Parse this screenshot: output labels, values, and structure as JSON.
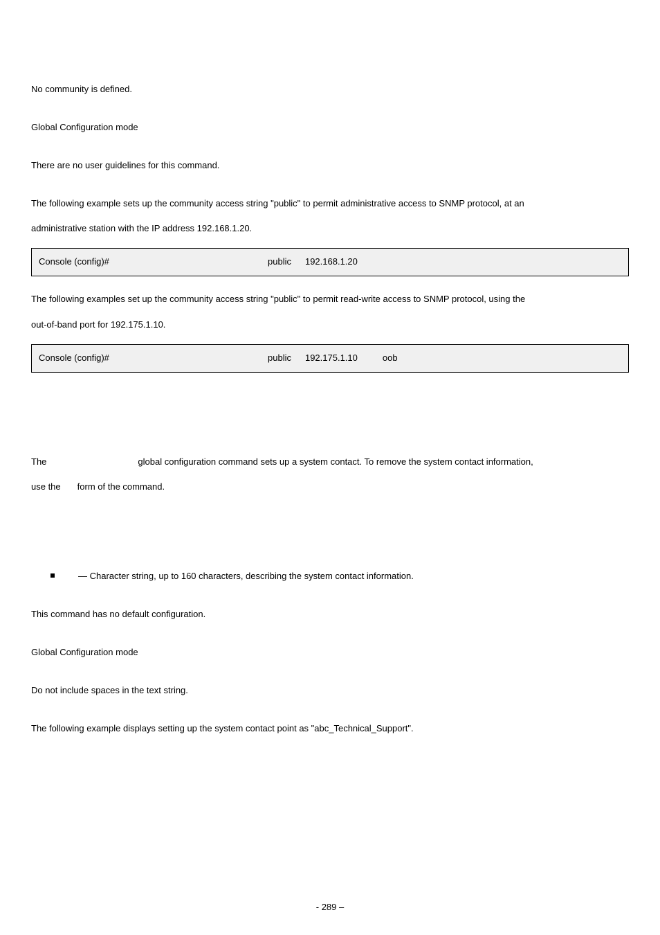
{
  "default_config": "No community is defined.",
  "command_mode": "Global Configuration mode",
  "user_guidelines_1": "There are no user guidelines for this command.",
  "example_intro_1a": "The following example sets up the community access string \"public\" to permit administrative access to SNMP protocol, at an",
  "example_intro_1b": "administrative station with the IP address 192.168.1.20.",
  "code1": {
    "prompt": "Console (config)#",
    "p1": "public",
    "p2": "192.168.1.20"
  },
  "example_intro_2a": "The following examples set up the community access string \"public\" to permit read-write access to SNMP protocol, using the",
  "example_intro_2b": "out-of-band port for 192.175.1.10.",
  "code2": {
    "prompt": "Console (config)#",
    "p1": "public",
    "p2": "192.175.1.10",
    "p3": "oob"
  },
  "desc_line1_a": "The",
  "desc_line1_b": "global configuration command sets up a system contact. To remove the system contact information,",
  "desc_line2_a": "use the",
  "desc_line2_b": "form of the command.",
  "param_text": " — Character string, up to 160 characters, describing the system contact information.",
  "default_config_2": "This command has no default configuration.",
  "command_mode_2": "Global Configuration mode",
  "user_guidelines_2": "Do not include spaces in the text string.",
  "example_intro_3": "The following example displays setting up the system contact point as \"abc_Technical_Support\".",
  "footer": "- 289 –"
}
